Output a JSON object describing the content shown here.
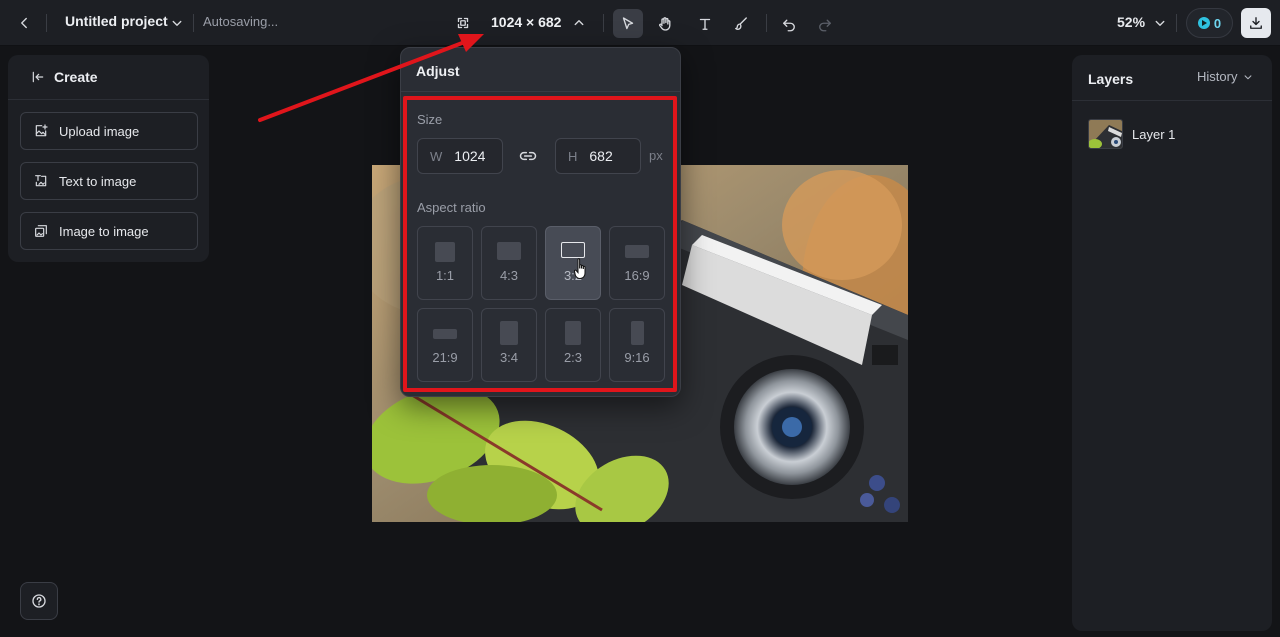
{
  "header": {
    "project_title": "Untitled project",
    "autosave_status": "Autosaving...",
    "canvas_size": "1024 × 682",
    "zoom": "52%",
    "credits": "0",
    "tools": [
      {
        "name": "select",
        "icon": "pointer-icon",
        "active": true
      },
      {
        "name": "hand",
        "icon": "hand-icon",
        "active": false
      },
      {
        "name": "text",
        "icon": "text-icon",
        "active": false
      },
      {
        "name": "brush",
        "icon": "brush-icon",
        "active": false
      },
      {
        "name": "undo",
        "icon": "undo-icon",
        "active": false
      },
      {
        "name": "redo",
        "icon": "redo-icon",
        "active": false
      }
    ]
  },
  "left_panel": {
    "title": "Create",
    "buttons": [
      {
        "label": "Upload image",
        "icon": "upload-image-icon"
      },
      {
        "label": "Text to image",
        "icon": "text-to-image-icon"
      },
      {
        "label": "Image to image",
        "icon": "image-to-image-icon"
      }
    ]
  },
  "adjust": {
    "title": "Adjust",
    "size_label": "Size",
    "width_prefix": "W",
    "width_value": "1024",
    "height_prefix": "H",
    "height_value": "682",
    "unit": "px",
    "aspect_label": "Aspect ratio",
    "ratios": [
      {
        "label": "1:1",
        "selected": false
      },
      {
        "label": "4:3",
        "selected": false
      },
      {
        "label": "3:2",
        "selected": true
      },
      {
        "label": "16:9",
        "selected": false
      },
      {
        "label": "21:9",
        "selected": false
      },
      {
        "label": "3:4",
        "selected": false
      },
      {
        "label": "2:3",
        "selected": false
      },
      {
        "label": "9:16",
        "selected": false
      }
    ]
  },
  "right_panel": {
    "title": "Layers",
    "history_label": "History",
    "layers": [
      {
        "name": "Layer 1"
      }
    ]
  },
  "colors": {
    "accent_red": "#e0151b",
    "credit_accent": "#2fc2e0",
    "panel_bg": "#1d1f24",
    "canvas_bg": "#131417"
  }
}
